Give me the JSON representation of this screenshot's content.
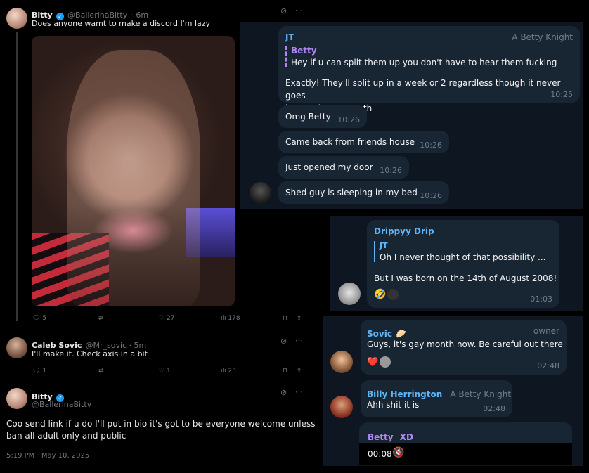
{
  "tweet1": {
    "name": "Bitty",
    "handle": "@BallerinaBitty",
    "time": "· 6m",
    "text": "Does anyone wamt to make a discord I'm lazy",
    "replies": "5",
    "likes": "27",
    "views": "178"
  },
  "tweet2": {
    "name": "Caleb Sovic",
    "handle": "@Mr_sovic · 5m",
    "text": "I'll make it. Check axis in a bit",
    "replies": "1",
    "likes": "1",
    "views": "23"
  },
  "tweet3": {
    "name": "Bitty",
    "handle": "@BallerinaBitty",
    "text_line1": "Coo send link if u do I'll put in bio it's got to be everyone welcome unless",
    "text_line2": "ban all adult only and public",
    "timestamp": "5:19 PM · May 10, 2025"
  },
  "tg1": {
    "sender": "JT",
    "title": "A Betty Knight",
    "quote_name": "Betty",
    "quote_text": "Hey if u can split them up you don't have to hear them fucking",
    "reply_line1": "Exactly! They'll split up in a week or 2 regardless though it never goes",
    "reply_line2": "longer than a month",
    "reply_time": "10:25",
    "messages": [
      {
        "text": "Omg Betty",
        "time": "10:26"
      },
      {
        "text": "Came back from friends house",
        "time": "10:26"
      },
      {
        "text": "Just opened my door",
        "time": "10:26"
      },
      {
        "text": "Shed guy is sleeping in my bed",
        "time": "10:26"
      }
    ]
  },
  "tg2": {
    "sender": "Drippyy Drip",
    "quote_name": "JT",
    "quote_text": "Oh I never thought of that possibility ...",
    "text": "But I was born on the 14th of August 2008!",
    "time": "01:03",
    "reaction_emoji": "🤣"
  },
  "tg3": {
    "sender": "Sovic",
    "sender_emoji": "🥟",
    "role": "owner",
    "text": "Guys, it's gay month now. Be careful out there",
    "reaction": "❤️",
    "time": "02:48",
    "sender2": "Billy Herrington",
    "title2": "A Betty Knight",
    "text2": "Ahh shit it is",
    "time2": "02:48",
    "sender3": "Betty",
    "sender3_emoji": "XD",
    "voice_time": "00:08"
  },
  "colors": {
    "twitter_blue": "#1d9bf0",
    "tg_bg": "#0e1621",
    "tg_bubble": "#182533",
    "name_jt": "#5eb5f7",
    "name_betty": "#b087f5",
    "name_drippy": "#5eb5f7",
    "name_sovic": "#5eb5f7"
  }
}
